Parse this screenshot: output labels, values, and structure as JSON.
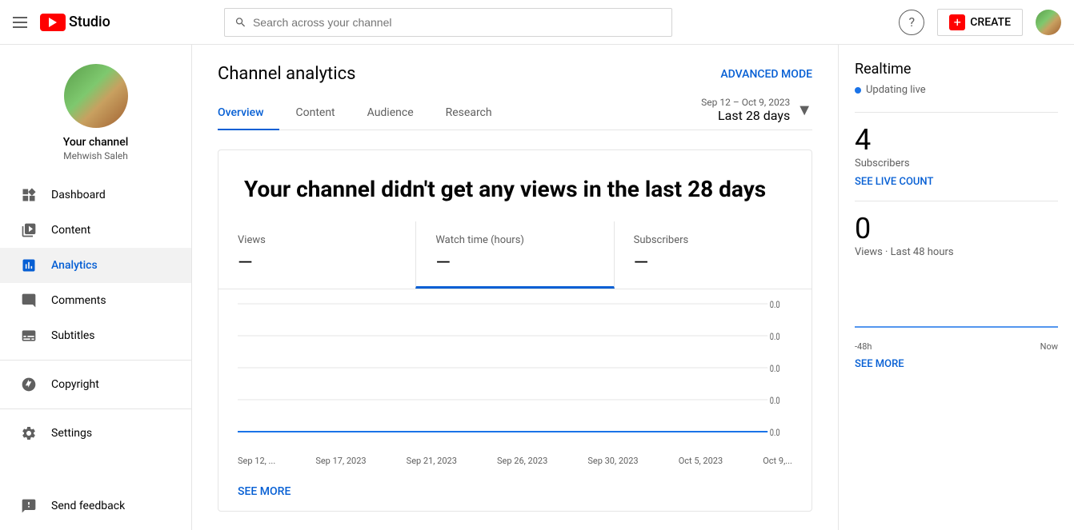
{
  "header": {
    "menu_icon": "hamburger-icon",
    "logo_text": "Studio",
    "search_placeholder": "Search across your channel",
    "create_label": "CREATE",
    "help_icon": "help-icon",
    "avatar_alt": "user-avatar"
  },
  "sidebar": {
    "channel_name": "Your channel",
    "channel_handle": "Mehwish Saleh",
    "nav_items": [
      {
        "id": "dashboard",
        "label": "Dashboard",
        "icon": "dashboard-icon"
      },
      {
        "id": "content",
        "label": "Content",
        "icon": "content-icon"
      },
      {
        "id": "analytics",
        "label": "Analytics",
        "icon": "analytics-icon",
        "active": true
      },
      {
        "id": "comments",
        "label": "Comments",
        "icon": "comments-icon"
      },
      {
        "id": "subtitles",
        "label": "Subtitles",
        "icon": "subtitles-icon"
      },
      {
        "id": "copyright",
        "label": "Copyright",
        "icon": "copyright-icon"
      },
      {
        "id": "settings",
        "label": "Settings",
        "icon": "settings-icon"
      }
    ],
    "send_feedback": "Send feedback"
  },
  "main": {
    "page_title": "Channel analytics",
    "advanced_mode": "ADVANCED MODE",
    "date_range_label": "Sep 12 – Oct 9, 2023",
    "date_range_main": "Last 28 days",
    "tabs": [
      {
        "id": "overview",
        "label": "Overview",
        "active": true
      },
      {
        "id": "content",
        "label": "Content"
      },
      {
        "id": "audience",
        "label": "Audience"
      },
      {
        "id": "research",
        "label": "Research"
      }
    ],
    "chart": {
      "headline": "Your channel didn't get any views in the last 28 days",
      "metrics": [
        {
          "label": "Views",
          "value": "—"
        },
        {
          "label": "Watch time (hours)",
          "value": "—",
          "active": true
        },
        {
          "label": "Subscribers",
          "value": "—"
        }
      ],
      "y_labels": [
        "0.0",
        "0.0",
        "0.0",
        "0.0",
        "0.0"
      ],
      "x_labels": [
        "Sep 12, ...",
        "Sep 17, 2023",
        "Sep 21, 2023",
        "Sep 26, 2023",
        "Sep 30, 2023",
        "Oct 5, 2023",
        "Oct 9,..."
      ],
      "see_more": "SEE MORE"
    }
  },
  "right_panel": {
    "realtime_title": "Realtime",
    "live_label": "Updating live",
    "subscribers_count": "4",
    "subscribers_label": "Subscribers",
    "see_live_count": "SEE LIVE COUNT",
    "views_count": "0",
    "views_label": "Views · Last 48 hours",
    "axis_left": "-48h",
    "axis_right": "Now",
    "see_more": "SEE MORE"
  }
}
